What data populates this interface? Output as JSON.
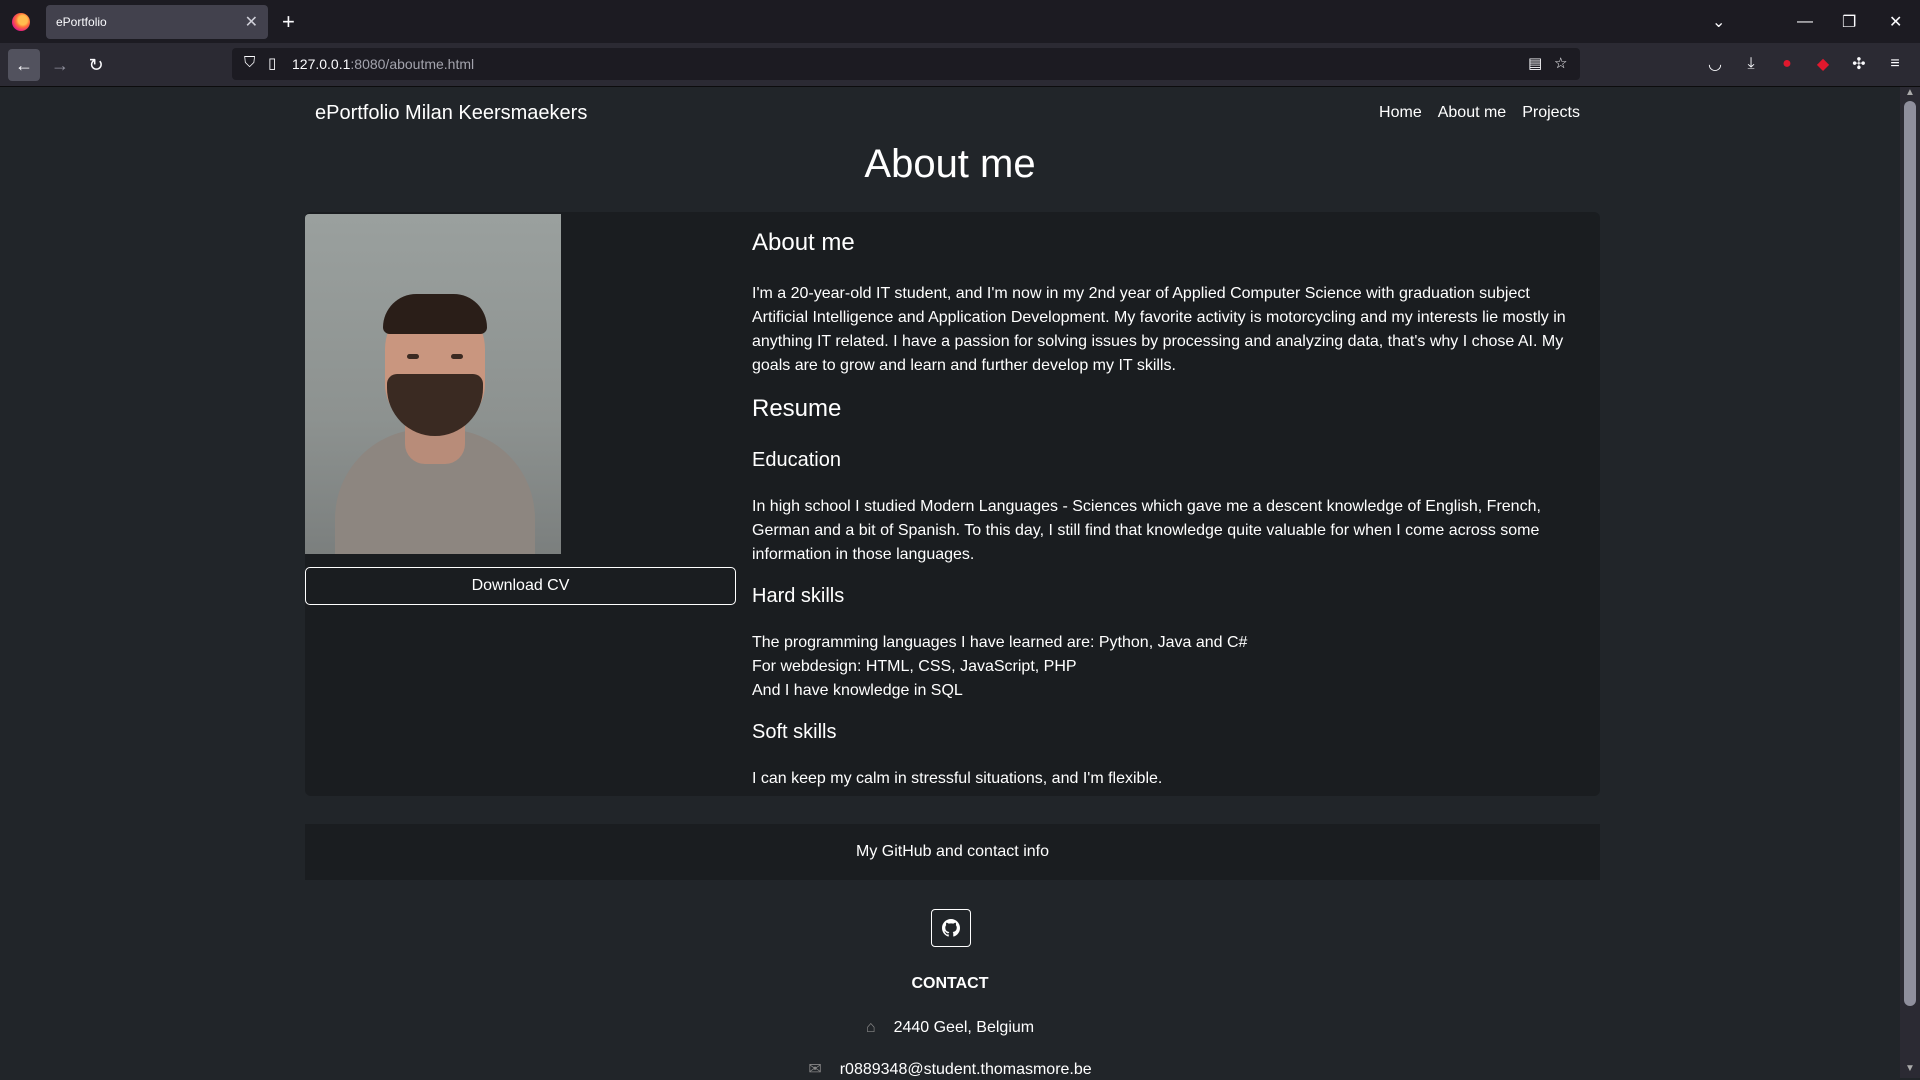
{
  "browser": {
    "tab_title": "ePortfolio",
    "url_host": "127.0.0.1",
    "url_path": ":8080/aboutme.html"
  },
  "site": {
    "brand": "ePortfolio Milan Keersmaekers",
    "menu": [
      "Home",
      "About me",
      "Projects"
    ],
    "page_title": "About me"
  },
  "profile": {
    "download_label": "Download CV"
  },
  "about": {
    "heading": "About me",
    "text": "I'm a 20-year-old IT student, and I'm now in my 2nd year of Applied Computer Science with graduation subject Artificial Intelligence and Application Development. My favorite activity is motorcycling and my interests lie mostly in anything IT related. I have a passion for solving issues by processing and analyzing data, that's why I chose AI. My goals are to grow and learn and further develop my IT skills."
  },
  "resume": {
    "heading": "Resume",
    "education_heading": "Education",
    "education_text": "In high school I studied Modern Languages - Sciences which gave me a descent knowledge of English, French, German and a bit of Spanish. To this day, I still find that knowledge quite valuable for when I come across some information in those languages.",
    "hard_heading": "Hard skills",
    "hard_lines": [
      "The programming languages I have learned are: Python, Java and C#",
      "For webdesign: HTML, CSS, JavaScript, PHP",
      "And I have knowledge in SQL"
    ],
    "soft_heading": "Soft skills",
    "soft_text": "I can keep my calm in stressful situations, and I'm flexible."
  },
  "footer": {
    "bar_text": "My GitHub and contact info",
    "contact_title": "CONTACT",
    "address": "2440 Geel, Belgium",
    "email": "r0889348@student.thomasmore.be"
  }
}
